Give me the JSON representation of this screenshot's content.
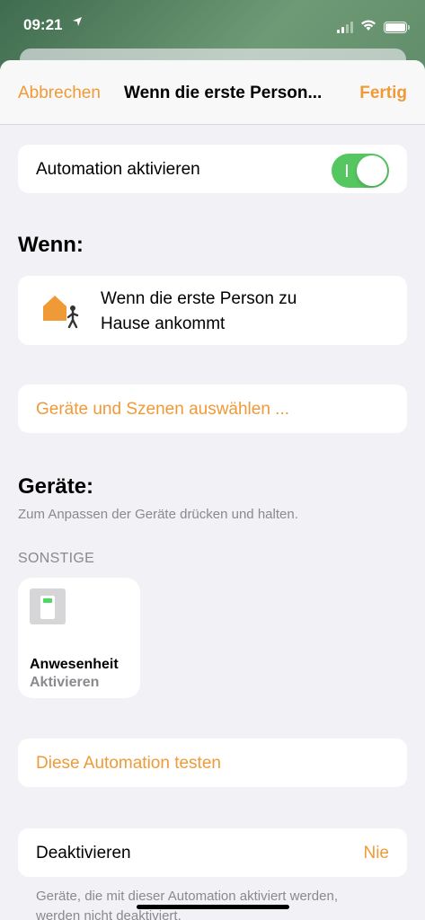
{
  "status_bar": {
    "time": "09:21"
  },
  "nav": {
    "cancel_label": "Abbrechen",
    "title": "Wenn die erste Person...",
    "done_label": "Fertig"
  },
  "automation_toggle": {
    "label": "Automation aktivieren",
    "enabled": true
  },
  "when_section": {
    "title": "Wenn:",
    "trigger_line1": "Wenn die erste Person zu",
    "trigger_line2": "Hause ankommt",
    "trigger_icon": "house-person-icon"
  },
  "select_devices_label": "Geräte und Szenen auswählen ...",
  "devices_section": {
    "title": "Geräte:",
    "hint": "Zum Anpassen der Geräte drücken und halten.",
    "group_header": "SONSTIGE",
    "tiles": [
      {
        "name": "Anwesenheit",
        "status": "Aktivieren",
        "icon": "switch-icon"
      }
    ]
  },
  "test_automation_label": "Diese Automation testen",
  "deactivate_row": {
    "label": "Deaktivieren",
    "value": "Nie"
  },
  "footnote": {
    "line1": "Geräte, die mit dieser Automation aktiviert werden,",
    "line2": "werden nicht deaktiviert."
  },
  "colors": {
    "accent": "#f09a37",
    "toggle_on": "#55c760",
    "background": "#f2f1f6"
  }
}
